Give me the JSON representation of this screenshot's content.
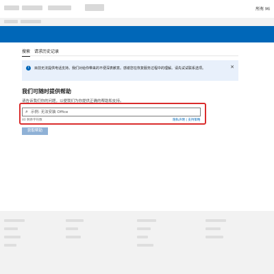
{
  "header": {
    "account_text": "所有 Mi"
  },
  "tabs": [
    {
      "label": "搜索",
      "active": true
    },
    {
      "label": "请求历史记录",
      "active": false
    }
  ],
  "notice": {
    "icon": "info-icon",
    "text": "目前无法提供电话支持。我们对给你带来的不便深表歉意。感谢您在恢复服务过程中的理解。请先试试联系选项。"
  },
  "help": {
    "heading": "我们可随时提供帮助",
    "subtext": "请告诉我们你的问题，以便我们为你提供正确的帮助和支持。",
    "search_placeholder": "示例: 无法安装 Office",
    "char_count": "80 剩余字符数",
    "link_privacy": "隐私声明",
    "link_separator": " | ",
    "link_support": "支持策略",
    "button_label": "获取帮助"
  },
  "colors": {
    "brand_blue": "#0067b8",
    "highlight_red": "#d92b2b",
    "notice_bg": "#e8f0fb"
  }
}
